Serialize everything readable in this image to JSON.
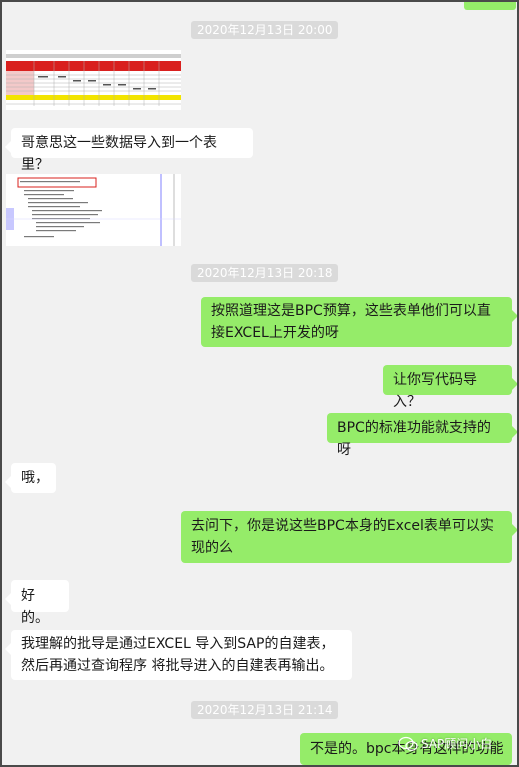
{
  "messages": {
    "ts1": "2020年12月13日 20:00",
    "m1": "哥意思这一些数据导入到一个表里？",
    "ts2": "2020年12月13日 20:18",
    "m2": "按照道理这是BPC预算，这些表单他们可以直接EXCEL上开发的呀",
    "m3": "让你写代码导入？",
    "m4": "BPC的标准功能就支持的呀",
    "m5": "哦，",
    "m6": "去问下，你是说这些BPC本身的Excel表单可以实现的么",
    "m7": "好的。",
    "m8": "我理解的批导是通过EXCEL 导入到SAP的自建表，然后再通过查询程序 将批导进入的自建表再输出。",
    "ts3": "2020年12月13日 21:14",
    "m9": "不是的。bpc本身有这样的功能"
  },
  "watermark": {
    "text": "SAP顾问小白",
    "icon": "wechat-icon"
  },
  "colors": {
    "background": "#f1f1f1",
    "left_bubble": "#ffffff",
    "right_bubble": "#95ec69",
    "timestamp_bg": "#dadada",
    "sheet_header_red": "#d9201e",
    "sheet_total_yellow": "#f2e400"
  }
}
